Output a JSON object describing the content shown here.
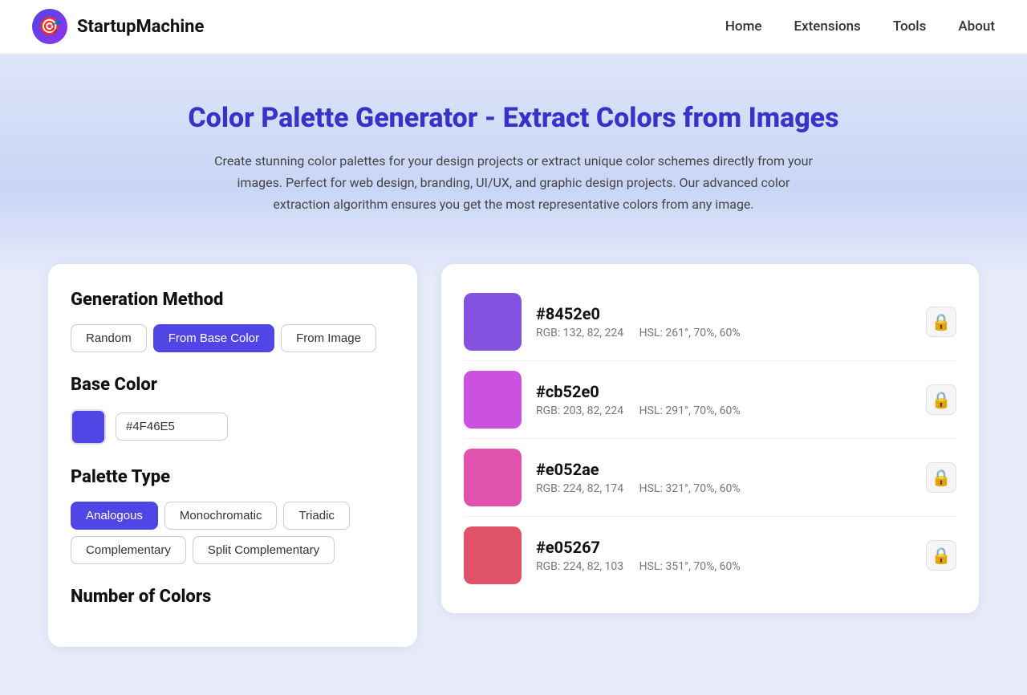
{
  "nav": {
    "logo_icon": "🎯",
    "logo_text": "StartupMachine",
    "links": [
      {
        "label": "Home",
        "name": "home"
      },
      {
        "label": "Extensions",
        "name": "extensions"
      },
      {
        "label": "Tools",
        "name": "tools"
      },
      {
        "label": "About",
        "name": "about"
      }
    ]
  },
  "hero": {
    "title": "Color Palette Generator - Extract Colors from Images",
    "description": "Create stunning color palettes for your design projects or extract unique color schemes directly from your images. Perfect for web design, branding, UI/UX, and graphic design projects. Our advanced color extraction algorithm ensures you get the most representative colors from any image."
  },
  "left_panel": {
    "generation_method": {
      "title": "Generation Method",
      "buttons": [
        {
          "label": "Random",
          "name": "random",
          "active": false
        },
        {
          "label": "From Base Color",
          "name": "from-base-color",
          "active": true
        },
        {
          "label": "From Image",
          "name": "from-image",
          "active": false
        }
      ]
    },
    "base_color": {
      "title": "Base Color",
      "value": "#4F46E5",
      "color": "#4F46E5"
    },
    "palette_type": {
      "title": "Palette Type",
      "buttons": [
        {
          "label": "Analogous",
          "name": "analogous",
          "active": true
        },
        {
          "label": "Monochromatic",
          "name": "monochromatic",
          "active": false
        },
        {
          "label": "Triadic",
          "name": "triadic",
          "active": false
        },
        {
          "label": "Complementary",
          "name": "complementary",
          "active": false
        },
        {
          "label": "Split Complementary",
          "name": "split-complementary",
          "active": false
        }
      ]
    },
    "num_colors": {
      "title": "Number of Colors"
    }
  },
  "colors": [
    {
      "hex": "#8452e0",
      "color": "#8452e0",
      "rgb": "RGB: 132, 82, 224",
      "hsl": "HSL: 261°, 70%, 60%"
    },
    {
      "hex": "#cb52e0",
      "color": "#cb52e0",
      "rgb": "RGB: 203, 82, 224",
      "hsl": "HSL: 291°, 70%, 60%"
    },
    {
      "hex": "#e052ae",
      "color": "#e052ae",
      "rgb": "RGB: 224, 82, 174",
      "hsl": "HSL: 321°, 70%, 60%"
    },
    {
      "hex": "#e05267",
      "color": "#e05267",
      "rgb": "RGB: 224, 82, 103",
      "hsl": "HSL: 351°, 70%, 60%"
    }
  ],
  "icons": {
    "lock": "🔒"
  }
}
